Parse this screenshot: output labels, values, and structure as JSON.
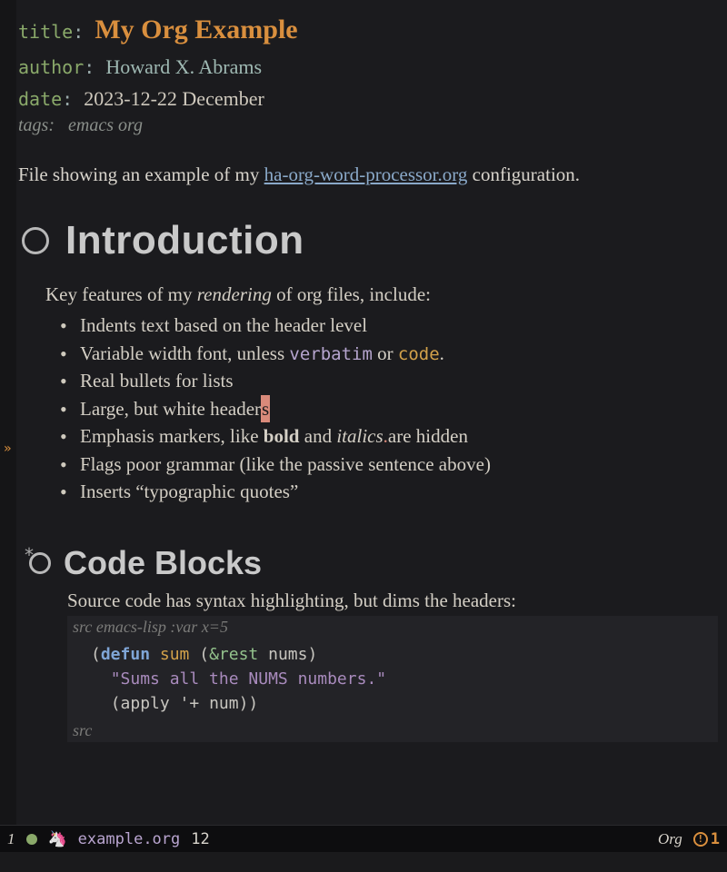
{
  "meta": {
    "title_key": "title",
    "title_val": "My Org Example",
    "author_key": "author",
    "author_val": "Howard X. Abrams",
    "date_key": "date",
    "date_val": "2023-12-22 December",
    "tags_key": "tags:",
    "tags_val": "emacs org"
  },
  "intro": {
    "pre": "File showing an example of my ",
    "link": "ha-org-word-processor.org",
    "post": " configuration."
  },
  "h1": "Introduction",
  "features_lead_pre": "Key features of my ",
  "features_lead_em": "rendering",
  "features_lead_post": " of org files, include:",
  "bullets": {
    "b0": "Indents text based on the header level",
    "b1_pre": "Variable width font, unless ",
    "b1_verb": "verbatim",
    "b1_mid": " or ",
    "b1_code": "code",
    "b1_post": ".",
    "b2": "Real bullets for lists",
    "b3_pre": "Large, but white header",
    "b3_cursor": "s",
    "b4_pre": "Emphasis markers, like ",
    "b4_bold": "bold",
    "b4_mid": " and ",
    "b4_ital": "italics",
    "b4_dot": ".",
    "b4_post": "are hidden",
    "b5": "Flags poor grammar (like the passive sentence above)",
    "b6": "Inserts “typographic quotes”"
  },
  "h2": "Code Blocks",
  "src_intro": "Source code has syntax highlighting, but dims the headers:",
  "src": {
    "header_kw": "src",
    "header_rest": " emacs-lisp :var x=5",
    "l1_open": "(",
    "l1_defun": "defun",
    "l1_sp1": " ",
    "l1_name": "sum",
    "l1_sp2": " (",
    "l1_amp": "&rest",
    "l1_sp3": " ",
    "l1_arg": "nums",
    "l1_close": ")",
    "l2_doc": "\"Sums all the NUMS numbers.\"",
    "l3_open": "(",
    "l3_apply": "apply",
    "l3_rest": " '+ num))",
    "footer": "src"
  },
  "modeline": {
    "window": "1",
    "filename": "example.org",
    "line": "12",
    "mode": "Org",
    "errcount": "1"
  },
  "fringe_mark": "»"
}
